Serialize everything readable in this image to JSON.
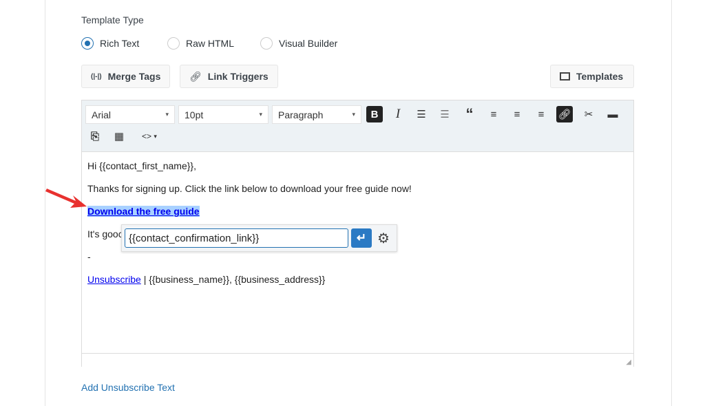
{
  "template_type": {
    "label": "Template Type",
    "options": [
      {
        "label": "Rich Text",
        "selected": true
      },
      {
        "label": "Raw HTML",
        "selected": false
      },
      {
        "label": "Visual Builder",
        "selected": false
      }
    ]
  },
  "buttons": {
    "merge_tags": "Merge Tags",
    "link_triggers": "Link Triggers",
    "templates": "Templates"
  },
  "toolbar": {
    "font": "Arial",
    "size": "10pt",
    "format": "Paragraph",
    "dropdown_arrow": "▾",
    "source_icon": "<>"
  },
  "content": {
    "greeting": "Hi {{contact_first_name}},",
    "line1": "Thanks for signing up. Click the link below to download your free guide now!",
    "link": "Download the free guide",
    "line2": "It's gooc",
    "dash": "-",
    "unsubscribe": "Unsubscribe",
    "footer": " | {{business_name}}, {{business_address}}"
  },
  "link_popup": {
    "url": "{{contact_confirmation_link}}"
  },
  "add_unsubscribe": "Add Unsubscribe Text",
  "colors": {
    "accent": "#2271b1",
    "toolbar_bg": "#edf2f5",
    "selection": "#a8d1ff",
    "arrow": "#e8312f"
  }
}
